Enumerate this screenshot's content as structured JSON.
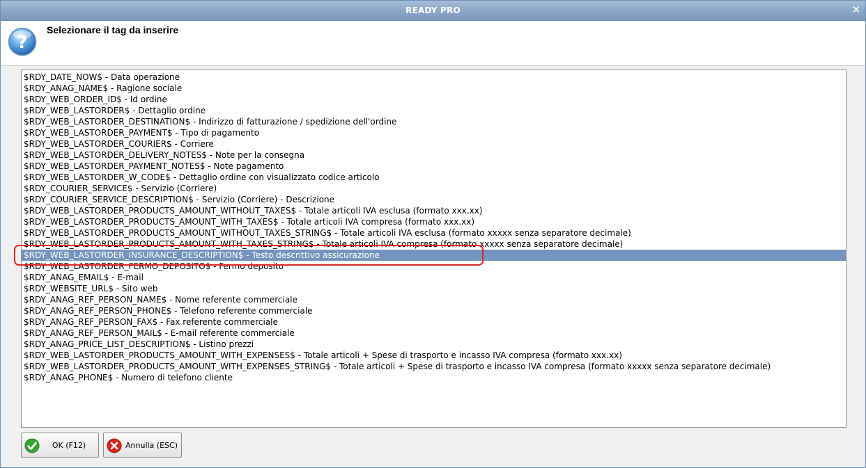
{
  "window": {
    "title": "READY PRO",
    "close_glyph": "✕"
  },
  "header": {
    "prompt": "Selezionare il tag da inserire",
    "icon": "question-icon"
  },
  "list": {
    "selected_index": 16,
    "items": [
      "$RDY_DATE_NOW$ - Data operazione",
      "$RDY_ANAG_NAME$ - Ragione sociale",
      "$RDY_WEB_ORDER_ID$ - Id ordine",
      "$RDY_WEB_LASTORDER$ - Dettaglio ordine",
      "$RDY_WEB_LASTORDER_DESTINATION$ - Indirizzo di fatturazione / spedizione dell'ordine",
      "$RDY_WEB_LASTORDER_PAYMENT$ - Tipo di pagamento",
      "$RDY_WEB_LASTORDER_COURIER$ - Corriere",
      "$RDY_WEB_LASTORDER_DELIVERY_NOTES$ - Note per la consegna",
      "$RDY_WEB_LASTORDER_PAYMENT_NOTES$ - Note pagamento",
      "$RDY_WEB_LASTORDER_W_CODE$ - Dettaglio ordine con visualizzato codice articolo",
      "$RDY_COURIER_SERVICE$ - Servizio (Corriere)",
      "$RDY_COURIER_SERVICE_DESCRIPTION$ - Servizio (Corriere) - Descrizione",
      "$RDY_WEB_LASTORDER_PRODUCTS_AMOUNT_WITHOUT_TAXES$ - Totale articoli IVA esclusa (formato xxx.xx)",
      "$RDY_WEB_LASTORDER_PRODUCTS_AMOUNT_WITH_TAXES$ - Totale articoli IVA compresa (formato xxx.xx)",
      "$RDY_WEB_LASTORDER_PRODUCTS_AMOUNT_WITHOUT_TAXES_STRING$ - Totale articoli IVA esclusa (formato xxxxx senza separatore decimale)",
      "$RDY_WEB_LASTORDER_PRODUCTS_AMOUNT_WITH_TAXES_STRING$ - Totale articoli IVA compresa (formato xxxxx senza separatore decimale)",
      "$RDY_WEB_LASTORDER_INSURANCE_DESCRIPTION$ - Testo descrittivo assicurazione",
      "$RDY_WEB_LASTORDER_FERMO_DEPOSITO$ - Fermo deposito",
      "$RDY_ANAG_EMAIL$ - E-mail",
      "$RDY_WEBSITE_URL$ - Sito web",
      "$RDY_ANAG_REF_PERSON_NAME$ - Nome referente commerciale",
      "$RDY_ANAG_REF_PERSON_PHONE$ - Telefono referente commerciale",
      "$RDY_ANAG_REF_PERSON_FAX$ - Fax referente commerciale",
      "$RDY_ANAG_REF_PERSON_MAIL$ - E-mail referente commerciale",
      "$RDY_ANAG_PRICE_LIST_DESCRIPTION$ - Listino prezzi",
      "$RDY_WEB_LASTORDER_PRODUCTS_AMOUNT_WITH_EXPENSES$ - Totale articoli + Spese di trasporto e incasso IVA compresa (formato xxx.xx)",
      "$RDY_WEB_LASTORDER_PRODUCTS_AMOUNT_WITH_EXPENSES_STRING$ - Totale articoli + Spese di trasporto e incasso IVA compresa (formato xxxxx senza separatore decimale)",
      "$RDY_ANAG_PHONE$ - Numero di telefono cliente"
    ]
  },
  "buttons": {
    "ok": {
      "label": "OK (F12)",
      "icon": "check-icon",
      "color": "#3aa335"
    },
    "cancel": {
      "label": "Annulla (ESC)",
      "icon": "cancel-icon",
      "color": "#d9261c"
    }
  },
  "annotation": {
    "color": "#e2262c"
  }
}
